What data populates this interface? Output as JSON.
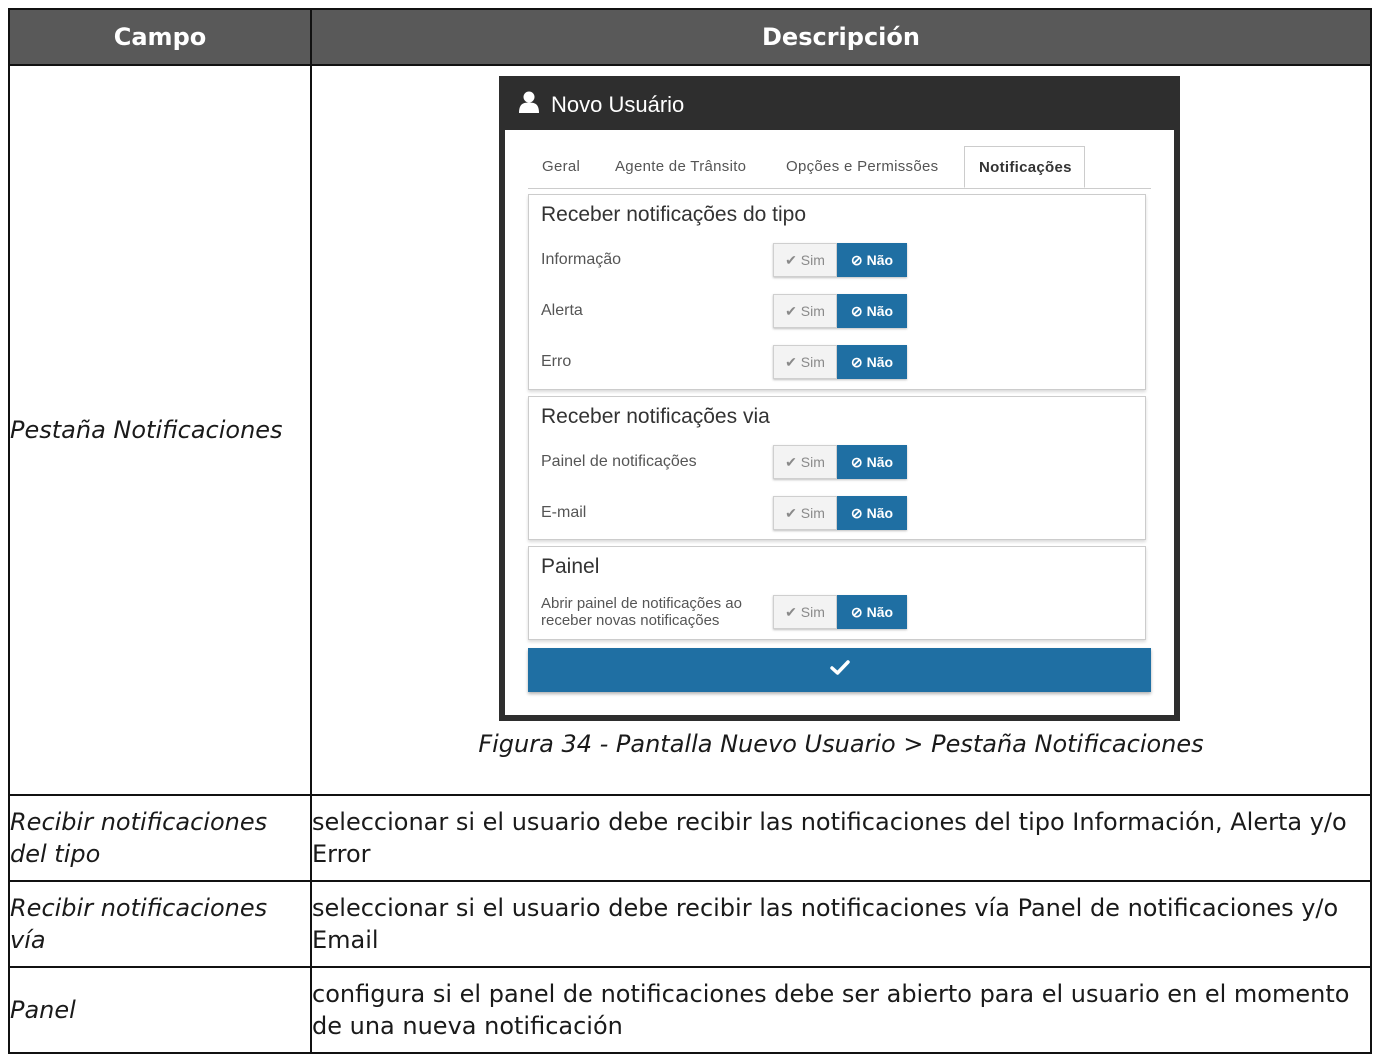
{
  "table": {
    "header": {
      "campo": "Campo",
      "descripcion": "Descripción"
    },
    "main_field": "Pestaña Notificaciones",
    "caption": "Figura 34 - Pantalla Nuevo Usuario > Pestaña Notificaciones",
    "rows": [
      {
        "field": "Recibir notificaciones del tipo",
        "desc": "seleccionar si el usuario debe recibir las notificaciones del tipo Información, Alerta y/o Error"
      },
      {
        "field": "Recibir notificaciones vía",
        "desc": "seleccionar si el usuario debe recibir las notificaciones vía Panel de notificaciones y/o Email"
      },
      {
        "field": "Panel",
        "desc": "configura si el panel de notificaciones debe ser abierto para el usuario en el momento de una nueva notificación"
      }
    ]
  },
  "screen": {
    "title": "Novo Usuário",
    "tabs": [
      "Geral",
      "Agente de Trânsito",
      "Opções e Permissões",
      "Notificações"
    ],
    "toggle": {
      "sim": "Sim",
      "nao": "Não"
    },
    "groups": [
      {
        "title": "Receber notificações do tipo",
        "items": [
          "Informação",
          "Alerta",
          "Erro"
        ]
      },
      {
        "title": "Receber notificações via",
        "items": [
          "Painel de notificações",
          "E-mail"
        ]
      },
      {
        "title": "Painel",
        "items": [
          "Abrir painel de notificações ao receber novas notificações"
        ]
      }
    ]
  },
  "colors": {
    "header_bg": "#595959",
    "dark_frame": "#2e2e2e",
    "accent": "#1f6fa3"
  }
}
